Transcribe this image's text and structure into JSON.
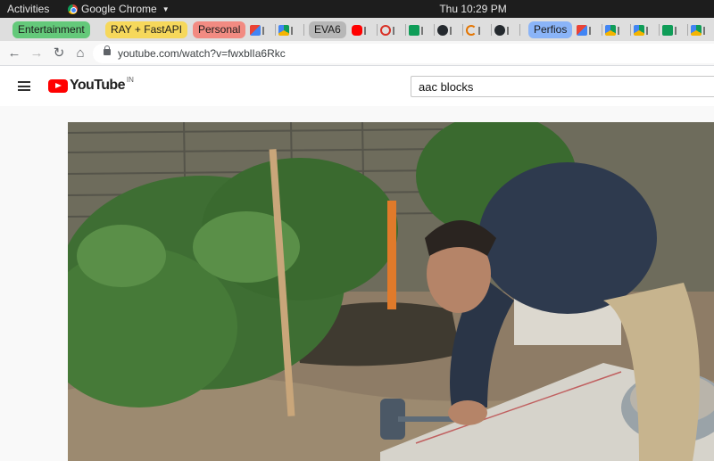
{
  "system_bar": {
    "activities": "Activities",
    "app_name": "Google Chrome",
    "clock": "Thu 10:29 PM"
  },
  "tab_groups": [
    {
      "label": "Entertainment",
      "color": "#64c97a"
    },
    {
      "label": "RAY + FastAPI",
      "color": "#f6d85b"
    },
    {
      "label": "Personal",
      "color": "#f28b82"
    },
    {
      "label": "EVA6",
      "color": "#b7b7b7"
    },
    {
      "label": "Perfios",
      "color": "#8ab4f8"
    }
  ],
  "tabs_favicons": [
    "gmail-icon",
    "google-drive-icon",
    "youtube-icon",
    "target-icon",
    "google-sheets-icon",
    "github-icon",
    "loading-icon",
    "github-icon",
    "gmail-icon",
    "google-drive-icon",
    "google-drive-icon",
    "google-sheets-icon",
    "google-drive-icon"
  ],
  "address_bar": {
    "url": "youtube.com/watch?v=fwxblIa6Rkc"
  },
  "youtube": {
    "logo_text": "YouTube",
    "country_code": "IN",
    "search_value": "aac blocks"
  },
  "colors": {
    "youtube_red": "#ff0000",
    "topbar": "#1d1d1d"
  }
}
